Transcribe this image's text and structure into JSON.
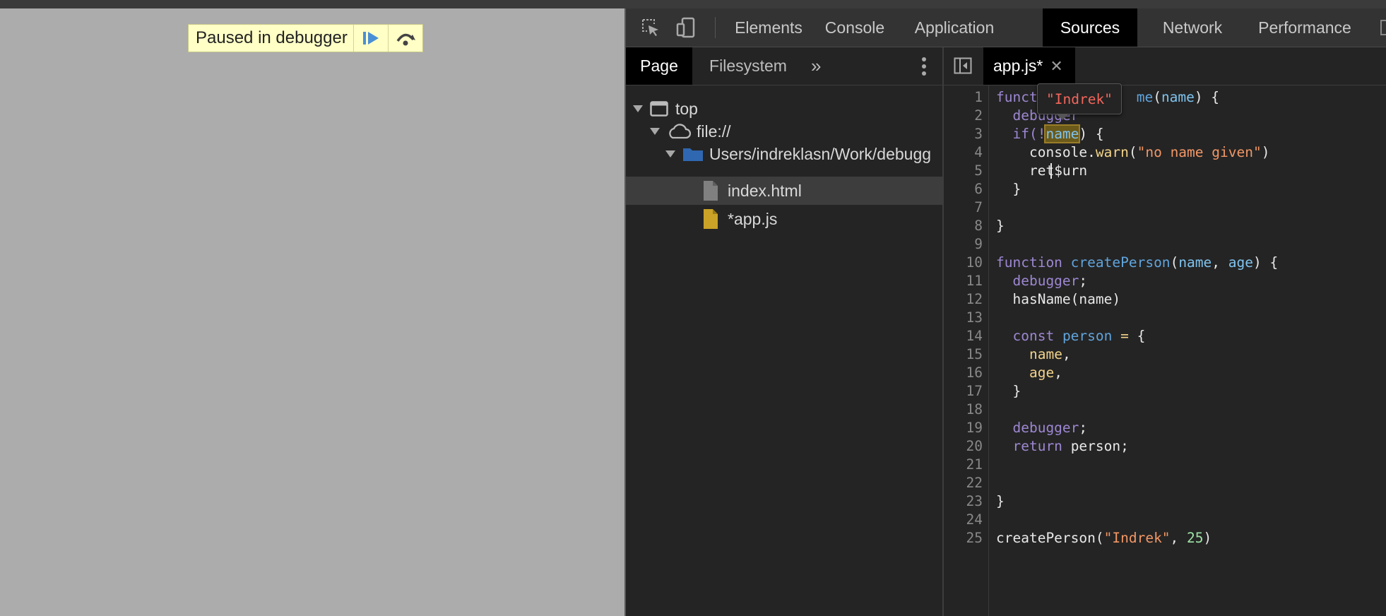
{
  "page": {
    "paused_text": "Paused in debugger"
  },
  "devtools": {
    "tabs": [
      "Elements",
      "Console",
      "Application",
      "Sources",
      "Network",
      "Performance"
    ],
    "active_tab": "Sources"
  },
  "navigator": {
    "tabs": [
      "Page",
      "Filesystem"
    ],
    "tree": [
      {
        "label": "top",
        "icon": "frame-icon"
      },
      {
        "label": "file://",
        "icon": "cloud-icon"
      },
      {
        "label": "Users/indreklasn/Work/debugg",
        "icon": "folder-icon"
      },
      {
        "label": "index.html",
        "icon": "file-icon"
      },
      {
        "label": "*app.js",
        "icon": "js-file-icon"
      }
    ]
  },
  "editor": {
    "tab_label": "app.js*",
    "tooltip_value": "\"Indrek\"",
    "line_numbers": [
      "1",
      "2",
      "3",
      "4",
      "5",
      "6",
      "7",
      "8",
      "9",
      "10",
      "11",
      "12",
      "13",
      "14",
      "15",
      "16",
      "17",
      "18",
      "19",
      "20",
      "21",
      "22",
      "23",
      "24",
      "25"
    ],
    "tokens": {
      "l1_kw": "funct",
      "l1_fn_tail": "me",
      "l1_paren_open": "(",
      "l1_param": "name",
      "l1_rest": ") {",
      "l2_kw": "debugger",
      "l3_if": "if(!",
      "l3_name": "name",
      "l3_rest": ") {",
      "l4_a": "console.",
      "l4_fn": "warn",
      "l4_b": "(",
      "l4_str": "\"no name given\"",
      "l4_c": ")",
      "l5_text": "ret$urn",
      "l6": "}",
      "l8": "}",
      "l10_kw": "function",
      "l10_fn": "createPerson",
      "l10_a": "(",
      "l10_p1": "name",
      "l10_b": ", ",
      "l10_p2": "age",
      "l10_c": ") {",
      "l11_kw": "debugger",
      "l11_semi": ";",
      "l12": "hasName(name)",
      "l14_kw": "const",
      "l14_var": "person",
      "l14_eq": "=",
      "l14_brace": "{",
      "l15": "name",
      "l15_comma": ",",
      "l16": "age",
      "l16_comma": ",",
      "l17": "}",
      "l19_kw": "debugger",
      "l19_semi": ";",
      "l20_kw": "return",
      "l20_rest": "person;",
      "l23": "}",
      "l25_a": "createPerson(",
      "l25_str": "\"Indrek\"",
      "l25_b": ", ",
      "l25_num": "25",
      "l25_c": ")"
    }
  },
  "colors": {
    "keyword": "#9d87d2",
    "function": "#60a4dc",
    "string": "#f29766",
    "number": "#9ee3a5",
    "property": "#f2d38a",
    "tooltip_value": "#f2665b",
    "overlay_bg": "#ffffc6"
  }
}
